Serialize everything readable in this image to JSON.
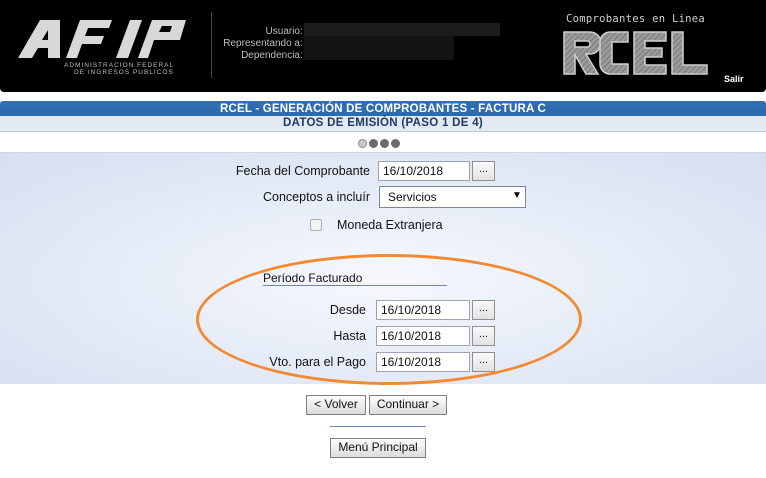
{
  "header": {
    "afip_letters": "AFIP",
    "afip_subtitle_line1": "ADMINISTRACION FEDERAL",
    "afip_subtitle_line2": "DE INGRESOS PUBLICOS",
    "user_labels": {
      "usuario": "Usuario",
      "representando": "Representando a",
      "dependencia": "Dependencia"
    },
    "colon": ":",
    "rcel_caption": "Comprobantes en Linea",
    "rcel_letters": "RCEL",
    "salir_label": "Salir"
  },
  "title": {
    "main": "RCEL - GENERACIÓN DE COMPROBANTES - FACTURA C",
    "sub": "DATOS DE EMISIÓN (PASO 1 DE 4)"
  },
  "steps": {
    "current": 1,
    "total": 4
  },
  "form": {
    "fecha_label": "Fecha del Comprobante",
    "fecha_value": "16/10/2018",
    "conceptos_label": "Conceptos a incluír",
    "conceptos_selected": "Servicios",
    "moneda_label": "Moneda Extranjera",
    "moneda_checked": false,
    "picker_label": "...",
    "periodo_title": "Período Facturado",
    "desde_label": "Desde",
    "desde_value": "16/10/2018",
    "hasta_label": "Hasta",
    "hasta_value": "16/10/2018",
    "vto_label": "Vto. para el Pago",
    "vto_value": "16/10/2018"
  },
  "actions": {
    "volver_label": "< Volver",
    "continuar_label": "Continuar >",
    "menu_label": "Menú Principal"
  },
  "colors": {
    "header_bg": "#000000",
    "title_band": "#2f6fb5",
    "highlight_oval": "#f28a32",
    "panel_bg": "#e2e9f6"
  }
}
